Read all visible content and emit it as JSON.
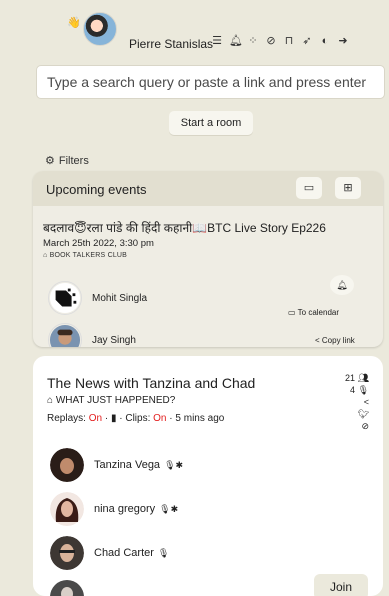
{
  "header": {
    "wave_emoji": "👋",
    "user_name": "Pierre Stanislas",
    "icons": [
      "sliders-icon",
      "bell-icon",
      "spinner-dots-icon",
      "compass-icon",
      "bookmark-icon",
      "send-icon",
      "theme-toggle-icon",
      "logout-icon"
    ]
  },
  "search": {
    "placeholder": "Type a search query or paste a link and press enter",
    "value": ""
  },
  "start_room_label": "Start a room",
  "filters_label": "Filters",
  "upcoming": {
    "title": "Upcoming events",
    "event": {
      "title": "बदलाव😇रला पांडे की हिंदी कहानी📖BTC Live Story Ep226",
      "date": "March 25th 2022, 3:30 pm",
      "club": "BOOK TALKERS CLUB",
      "hosts": [
        {
          "name": "Mohit Singla"
        },
        {
          "name": "Jay Singh"
        }
      ],
      "calendar_label": "To calendar",
      "copy_link_label": "Copy link"
    }
  },
  "room": {
    "title": "The News with Tanzina and Chad",
    "subtitle": "WHAT JUST HAPPENED?",
    "meta": {
      "replays_label": "Replays:",
      "replays_value": "On",
      "clips_label": "Clips:",
      "clips_value": "On",
      "time": "5 mins ago"
    },
    "stats": {
      "listeners": "21",
      "speakers": "4"
    },
    "speakers": [
      {
        "name": "Tanzina Vega",
        "badge": "🎙✱"
      },
      {
        "name": "nina gregory",
        "badge": "🎙✱"
      },
      {
        "name": "Chad Carter",
        "badge": "🎙"
      }
    ],
    "join_label": "Join"
  },
  "colors": {
    "background": "#ebe9dc",
    "accent_red": "#e31d1d",
    "card": "#ffffff"
  }
}
